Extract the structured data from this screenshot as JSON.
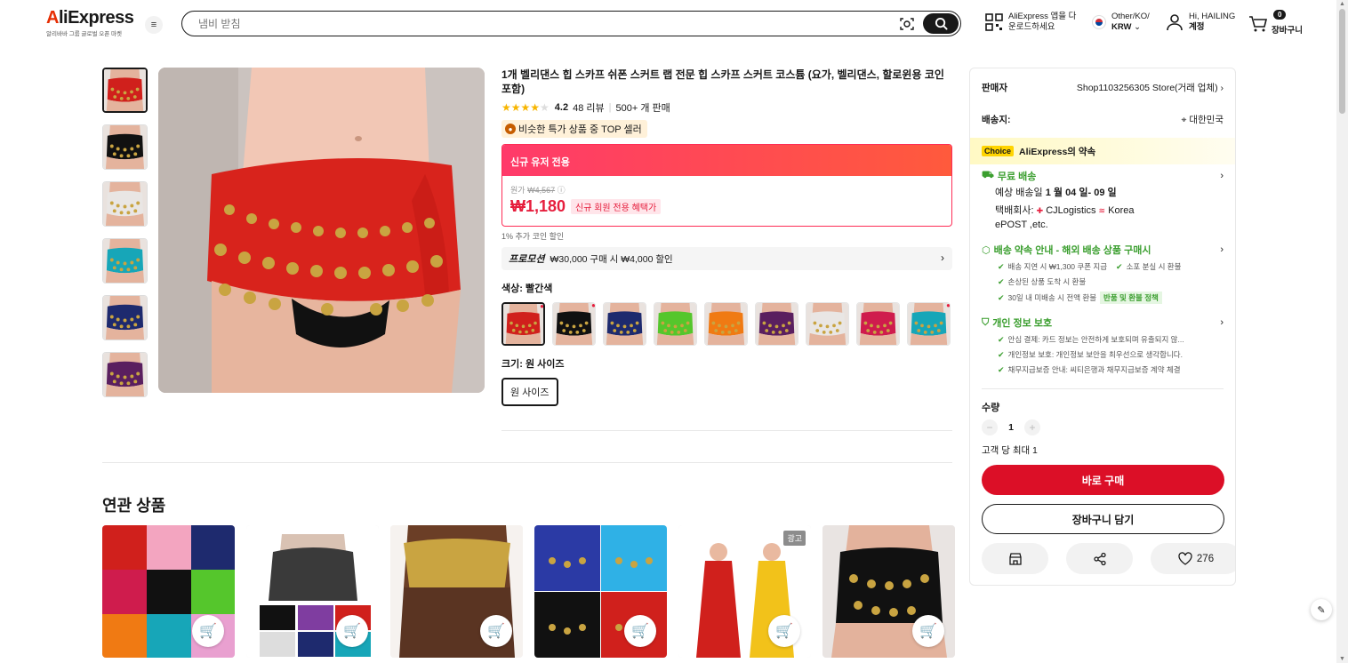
{
  "header": {
    "brand": "AliExpress",
    "brand_sub": "알리바바 그룹 글로벌 오픈 마켓",
    "search_placeholder": "냄비 받침",
    "app_line1": "AliExpress 앱을 다",
    "app_line2": "운로드하세요",
    "lang_line1": "Other/KO/",
    "lang_line2": "KRW",
    "account_line1": "Hi, HAILING",
    "account_line2": "계정",
    "cart_count": "0",
    "cart_label": "장바구니"
  },
  "product": {
    "title": "1개 벨리댄스 힙 스카프 쉬폰 스커트 랩 전문 힙 스카프 스커트 코스튬 (요가, 벨리댄스, 할로윈용 코인 포함)",
    "rating": "4.2",
    "rating_value": 4.2,
    "reviews": "48 리뷰",
    "sold": "500+ 개 판매",
    "top_seller": "비슷한 특가 상품 중 TOP 셀러",
    "new_user_banner": "신규 유저 전용",
    "orig_label": "원가",
    "orig_price": "₩4,567",
    "price": "₩1,180",
    "price_tag": "신규 회원 전용 혜택가",
    "coin_note": "1% 추가 코인 할인",
    "promo_label": "프로모션",
    "promo_text": "₩30,000 구매 시 ₩4,000 할인",
    "color_label": "색상: 빨간색",
    "size_label": "크기: 원 사이즈",
    "size_option": "원 사이즈"
  },
  "colors": [
    {
      "hex": "#d0201c",
      "hot": true
    },
    {
      "hex": "#111111",
      "hot": true
    },
    {
      "hex": "#1e2a6e",
      "hot": false
    },
    {
      "hex": "#55c62c",
      "hot": false
    },
    {
      "hex": "#f07a13",
      "hot": false
    },
    {
      "hex": "#5a1f5f",
      "hot": false
    },
    {
      "hex": "#e9e6e4",
      "hot": false
    },
    {
      "hex": "#cf1c4d",
      "hot": false
    },
    {
      "hex": "#17a6b8",
      "hot": true
    }
  ],
  "thumb_colors": [
    "#d0201c",
    "#111111",
    "#e9e6e4",
    "#17a6b8",
    "#1e2a6e",
    "#5a1f5f"
  ],
  "related": {
    "title": "연관 상품",
    "ad_label": "광고"
  },
  "panel": {
    "seller_label": "판매자",
    "seller_value": "Shop1103256305 Store(거래 업체)",
    "ship_label": "배송지:",
    "ship_value": "대한민국",
    "choice_tag": "Choice",
    "choice_text": "AliExpress의 약속",
    "free_ship": "무료 배송",
    "eta_prefix": "예상 배송일",
    "eta_value": "1 월 04 일- 09 일",
    "carrier_prefix": "택배회사:",
    "carrier_1": "CJLogistics",
    "carrier_2": "Korea",
    "carrier_3": "ePOST ,etc.",
    "promise_title": "배송 약속 안내 - 해외 배송 상품 구매시",
    "promise_1": "배송 지연 시 ₩1,300 쿠폰 지급",
    "promise_2": "소포 분실 시 환불",
    "promise_3": "손상된 상품 도착 시 환불",
    "promise_4": "30일 내 미배송 시 전액 환불",
    "policy": "반품 및 환불 정책",
    "privacy_title": "개인 정보 보호",
    "privacy_1": "안심 결제: 카드 정보는 안전하게 보호되며 유출되지 않...",
    "privacy_2": "개인정보 보호: 개인정보 보안을 최우선으로 생각합니다.",
    "privacy_3": "채무지급보증 안내: 씨티은행과 채무지급보증 계약 체결",
    "qty_label": "수량",
    "qty_value": "1",
    "limit": "고객 당 최대 1",
    "buy": "바로 구매",
    "add_cart": "장바구니 담기",
    "wish_count": "276"
  }
}
